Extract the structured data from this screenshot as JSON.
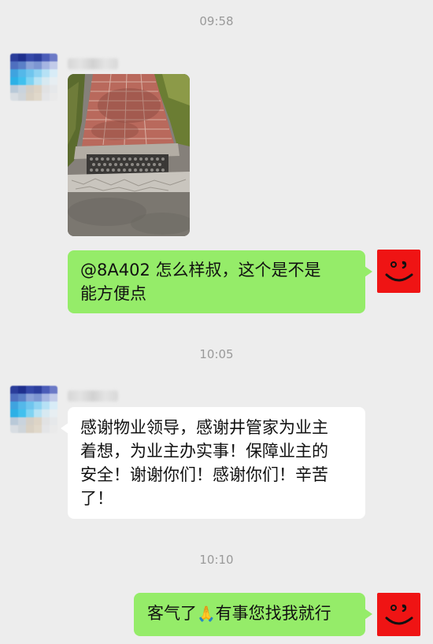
{
  "chat": {
    "timestamps": [
      "09:58",
      "10:05",
      "10:10"
    ],
    "messages": [
      {
        "side": "left",
        "type": "image",
        "sender_name": "",
        "image_subject": "brick sidewalk with metal drain grate"
      },
      {
        "side": "right",
        "type": "text",
        "lines": [
          "@8A402  怎么样叔，这个是不是",
          "能方便点"
        ]
      },
      {
        "side": "left",
        "type": "text",
        "sender_name": "",
        "lines": [
          "感谢物业领导，感谢井管家为业主",
          "着想，为业主办实事！保障业主的",
          "安全！谢谢你们！感谢你们！辛苦",
          "了！"
        ]
      },
      {
        "side": "right",
        "type": "text",
        "text_before_emoji": "客气了",
        "emoji": "🙏",
        "text_after_emoji": "有事您找我就行"
      }
    ]
  },
  "colors": {
    "background": "#ededed",
    "sent_bubble": "#95ec69",
    "received_bubble": "#ffffff",
    "timestamp_text": "#9a9a9a",
    "own_avatar": "#ef1414"
  },
  "icons": {
    "own_avatar": "red-smiley-avatar-icon",
    "other_avatar": "pixelated-avatar-icon"
  }
}
